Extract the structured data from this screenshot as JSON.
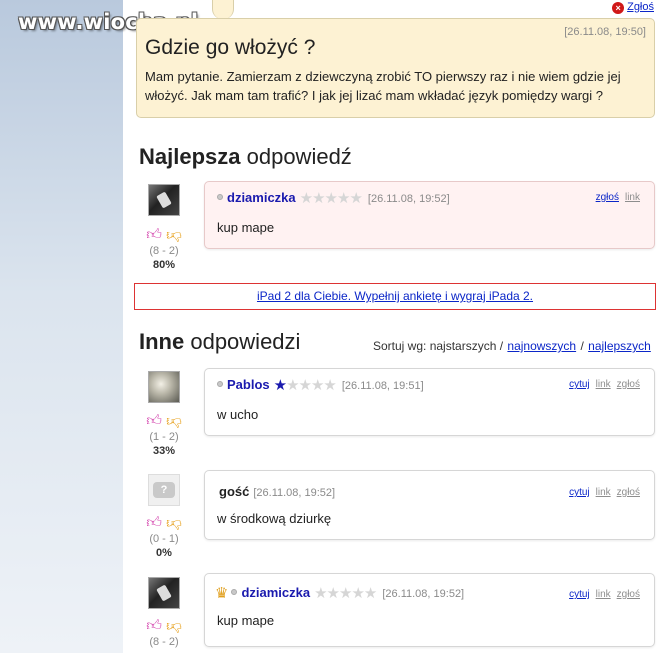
{
  "watermark": "www.wiocha.pl",
  "question": {
    "report_label": "Zgłoś",
    "date": "[26.11.08, 19:50]",
    "title": "Gdzie go włożyć ?",
    "body": "Mam pytanie. Zamierzam z dziewczyną zrobić TO pierwszy raz i nie wiem gdzie jej włożyć. Jak mam tam trafić? I jak jej lizać mam wkładać język pomiędzy wargi ?"
  },
  "best": {
    "heading_bold": "Najlepsza",
    "heading_rest": " odpowiedź",
    "answer": {
      "user": "dziamiczka",
      "stars": "★★★★★",
      "date": "[26.11.08, 19:52]",
      "report": "zgłoś",
      "link": "link",
      "text": "kup mape",
      "votes": "(8 - 2)",
      "percent": "80%"
    }
  },
  "ad": {
    "text": "iPad 2 dla Ciebie. Wypełnij ankietę i wygraj iPada 2."
  },
  "others": {
    "heading_bold": "Inne",
    "heading_rest": " odpowiedzi",
    "sort_label": "Sortuj wg: najstarszych /",
    "sort_newest": "najnowszych",
    "sort_sep": "/",
    "sort_best": "najlepszych",
    "answers": [
      {
        "user": "Pablos",
        "stars_half": "★",
        "stars_rest": "★★★★",
        "date": "[26.11.08, 19:51]",
        "quote": "cytuj",
        "link": "link",
        "report": "zgłoś",
        "text": "w ucho",
        "votes": "(1 - 2)",
        "percent": "33%"
      },
      {
        "user": "gość",
        "avatar_text": "?",
        "date": "[26.11.08, 19:52]",
        "quote": "cytuj",
        "link": "link",
        "report": "zgłoś",
        "text": "w środkową dziurkę",
        "votes": "(0 - 1)",
        "percent": "0%"
      },
      {
        "user": "dziamiczka",
        "stars": "★★★★★",
        "date": "[26.11.08, 19:52]",
        "quote": "cytuj",
        "link": "link",
        "report": "zgłoś",
        "text": "kup mape",
        "votes": "(8 - 2)"
      }
    ]
  },
  "icons": {
    "thumb_up": "thumbs-up",
    "thumb_down": "thumbs-down",
    "crown": "crown",
    "report": "close-circle"
  },
  "colors": {
    "question_bg": "#fdf2d3",
    "link": "#0b26c8",
    "best_bubble_bg": "#fff2f2",
    "ad_border": "#dd3333",
    "thumb_up": "#d54bb0",
    "thumb_down": "#e7a11d"
  }
}
